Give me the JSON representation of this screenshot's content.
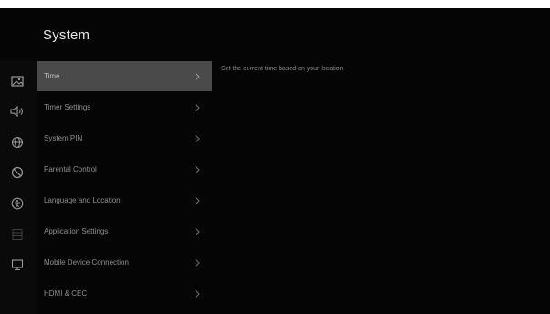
{
  "screen": {
    "title": "System"
  },
  "menu": {
    "items": [
      {
        "label": "Time",
        "selected": true
      },
      {
        "label": "Timer Settings",
        "selected": false
      },
      {
        "label": "System PIN",
        "selected": false
      },
      {
        "label": "Parental Control",
        "selected": false
      },
      {
        "label": "Language and Location",
        "selected": false
      },
      {
        "label": "Application Settings",
        "selected": false
      },
      {
        "label": "Mobile Device Connection",
        "selected": false
      },
      {
        "label": "HDMI & CEC",
        "selected": false
      }
    ]
  },
  "description": {
    "text": "Set the current time based on your location."
  },
  "side_rail": {
    "icons": [
      "picture-icon",
      "sound-icon",
      "network-icon",
      "no-sign-icon",
      "accessibility-icon",
      "list-icon",
      "display-icon"
    ]
  },
  "colors": {
    "background": "#050505",
    "selected_row": "#4a4a4a",
    "text": "#8f8f8f",
    "title": "#e6e6e6"
  }
}
